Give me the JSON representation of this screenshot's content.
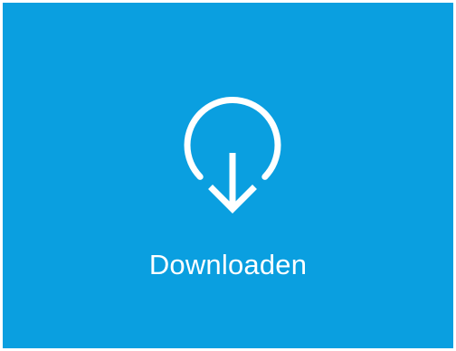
{
  "tile": {
    "label": "Downloaden",
    "icon": "download-circle-arrow-icon",
    "background_color": "#0a9fe0",
    "foreground_color": "#ffffff"
  }
}
